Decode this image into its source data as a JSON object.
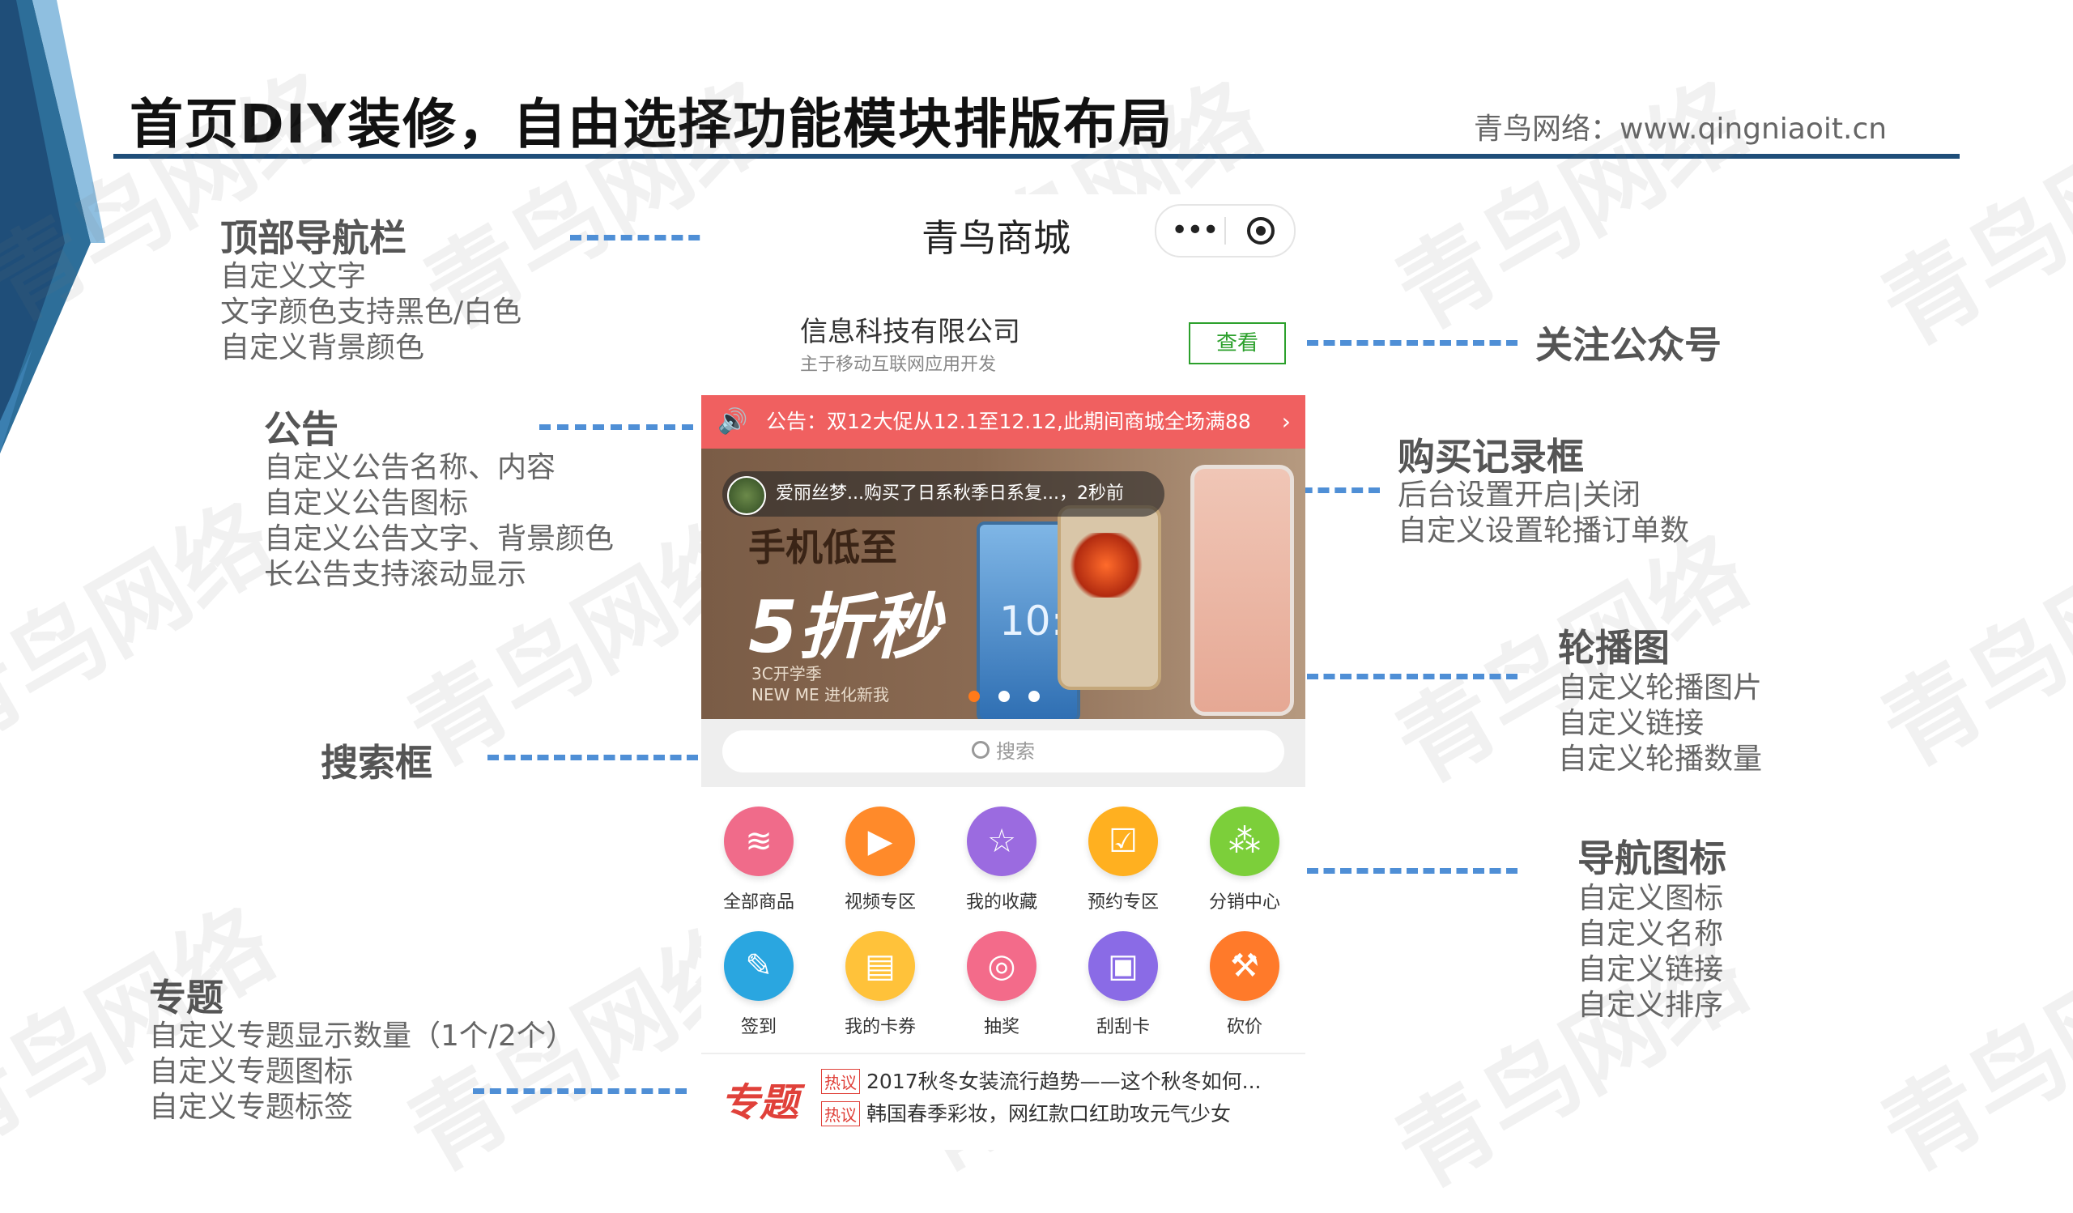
{
  "header": {
    "title": "首页DIY装修，自由选择功能模块排版布局",
    "credit": "青鸟网络：www.qingniaoit.cn"
  },
  "watermark": "青鸟网络",
  "annotations": {
    "topnav": {
      "title": "顶部导航栏",
      "lines": [
        "自定义文字",
        "文字颜色支持黑色/白色",
        "自定义背景颜色"
      ]
    },
    "notice": {
      "title": "公告",
      "lines": [
        "自定义公告名称、内容",
        "自定义公告图标",
        "自定义公告文字、背景颜色",
        "长公告支持滚动显示"
      ]
    },
    "search": {
      "title": "搜索框"
    },
    "topic": {
      "title": "专题",
      "lines": [
        "自定义专题显示数量（1个/2个）",
        "自定义专题图标",
        "自定义专题标签"
      ]
    },
    "follow": {
      "title": "关注公众号"
    },
    "purchase": {
      "title": "购买记录框",
      "lines": [
        "后台设置开启|关闭",
        "自定义设置轮播订单数"
      ]
    },
    "carousel": {
      "title": "轮播图",
      "lines": [
        "自定义轮播图片",
        "自定义链接",
        "自定义轮播数量"
      ]
    },
    "navicons": {
      "title": "导航图标",
      "lines": [
        "自定义图标",
        "自定义名称",
        "自定义链接",
        "自定义排序"
      ]
    }
  },
  "phone": {
    "nav_title": "青鸟商城",
    "capsule": {
      "more_icon": "more-icon",
      "target_icon": "target-icon"
    },
    "company": {
      "name": "信息科技有限公司",
      "desc": "主于移动互联网应用开发",
      "follow_label": "查看"
    },
    "notice": {
      "text": "公告：双12大促从12.1至12.12,此期间商城全场满88",
      "arrow": "›",
      "icon": "speaker-icon"
    },
    "banner": {
      "line1": "手机低至",
      "line2": "5折秒",
      "line3": "3C开学季",
      "line4": "NEW ME 进化新我",
      "clock": "10:35",
      "active_index": 0,
      "dot_count": 3
    },
    "purchase": {
      "text": "爱丽丝梦...购买了日系秋季日系复...，2秒前"
    },
    "search": {
      "placeholder": "搜索"
    },
    "nav_icons": [
      {
        "label": "全部商品",
        "icon": "layers-icon",
        "color": "#f06b8a"
      },
      {
        "label": "视频专区",
        "icon": "video-icon",
        "color": "#ff8a2a"
      },
      {
        "label": "我的收藏",
        "icon": "star-icon",
        "color": "#9b6be0"
      },
      {
        "label": "预约专区",
        "icon": "calendar-icon",
        "color": "#ffb020"
      },
      {
        "label": "分销中心",
        "icon": "network-icon",
        "color": "#7ccf3a"
      },
      {
        "label": "签到",
        "icon": "pen-icon",
        "color": "#2aa6e0"
      },
      {
        "label": "我的卡券",
        "icon": "card-icon",
        "color": "#ffc23a"
      },
      {
        "label": "抽奖",
        "icon": "wheel-icon",
        "color": "#f36b8a"
      },
      {
        "label": "刮刮卡",
        "icon": "scratch-icon",
        "color": "#8a6be6"
      },
      {
        "label": "砍价",
        "icon": "hammer-icon",
        "color": "#ff7a2a"
      }
    ],
    "topic": {
      "logo": "专题",
      "tag": "热议",
      "items": [
        "2017秋冬女装流行趋势——这个秋冬如何...",
        "韩国春季彩妆，网红款口红助攻元气少女"
      ]
    }
  }
}
